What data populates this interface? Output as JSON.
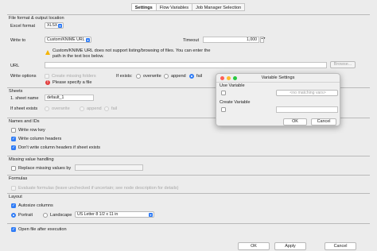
{
  "tabs": [
    "Settings",
    "Flow Variables",
    "Job Manager Selection"
  ],
  "file_section": {
    "title": "File format & output location",
    "excel_format_label": "Excel format",
    "excel_format_value": "XLSX",
    "write_to_label": "Write to",
    "write_to_value": "Custom/KNIME URL",
    "timeout_label": "Timeout",
    "timeout_value": "1,000",
    "warning": "Custom/KNIME URL does not support listing/browsing of files. You can enter the path in the text box below.",
    "url_label": "URL",
    "url_value": "",
    "browse_label": "Browse...",
    "write_options_label": "Write options",
    "create_missing_folders": "Create missing folders",
    "if_exists_label": "If exists:",
    "if_exists_options": [
      "overwrite",
      "append",
      "fail"
    ],
    "error_text": "Please specify a file"
  },
  "sheets_section": {
    "title": "Sheets",
    "sheet_name_label": "1. sheet name",
    "sheet_name_value": "default_1",
    "if_sheet_exists_label": "If sheet exists",
    "if_sheet_exists_options": [
      "overwrite",
      "append",
      "fail"
    ]
  },
  "names_section": {
    "title": "Names and IDs",
    "write_row_key": "Write row key",
    "write_column_headers": "Write column headers",
    "dont_write_headers": "Don't write column headers if sheet exists"
  },
  "missing_section": {
    "title": "Missing value handling",
    "replace_label": "Replace missing values by",
    "replace_value": ""
  },
  "formulas_section": {
    "title": "Formulas",
    "evaluate_label": "Evaluate formulas (leave unchecked if uncertain; see node description for details)"
  },
  "layout_section": {
    "title": "Layout",
    "autosize": "Autosize columns",
    "portrait": "Portrait",
    "landscape": "Landscape",
    "paper_size": "US Letter 8 1/2 x 11 in"
  },
  "open_file_after": "Open file after execution",
  "dialog": {
    "title": "Variable Settings",
    "use_variable_label": "Use Variable",
    "use_variable_value": "<no matching vars>",
    "create_variable_label": "Create Variable",
    "create_variable_value": "",
    "ok": "OK",
    "cancel": "Cancel"
  },
  "footer": {
    "ok": "OK",
    "apply": "Apply",
    "cancel": "Cancel"
  }
}
